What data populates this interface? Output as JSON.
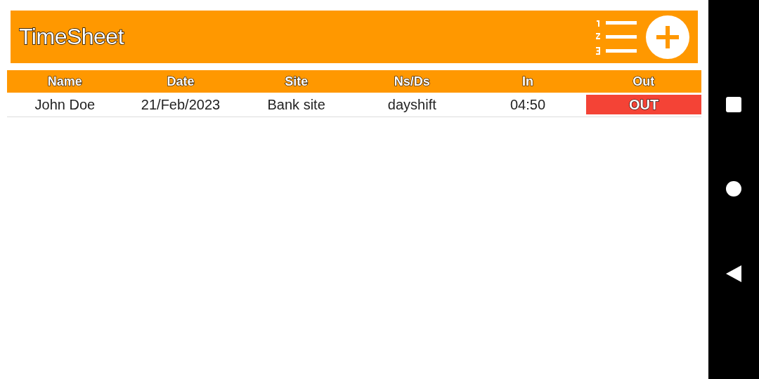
{
  "app_bar": {
    "title": "TimeSheet"
  },
  "table": {
    "columns": [
      "Name",
      "Date",
      "Site",
      "Ns/Ds",
      "In",
      "Out"
    ],
    "rows": [
      {
        "cells": [
          "John Doe",
          "21/Feb/2023",
          "Bank site",
          "dayshift",
          "04:50"
        ],
        "out": {
          "label": "OUT",
          "color": "#f44336"
        }
      }
    ]
  },
  "nav_bar": {
    "buttons": [
      {
        "kind": "recents"
      },
      {
        "kind": "home"
      },
      {
        "kind": "back"
      }
    ]
  }
}
